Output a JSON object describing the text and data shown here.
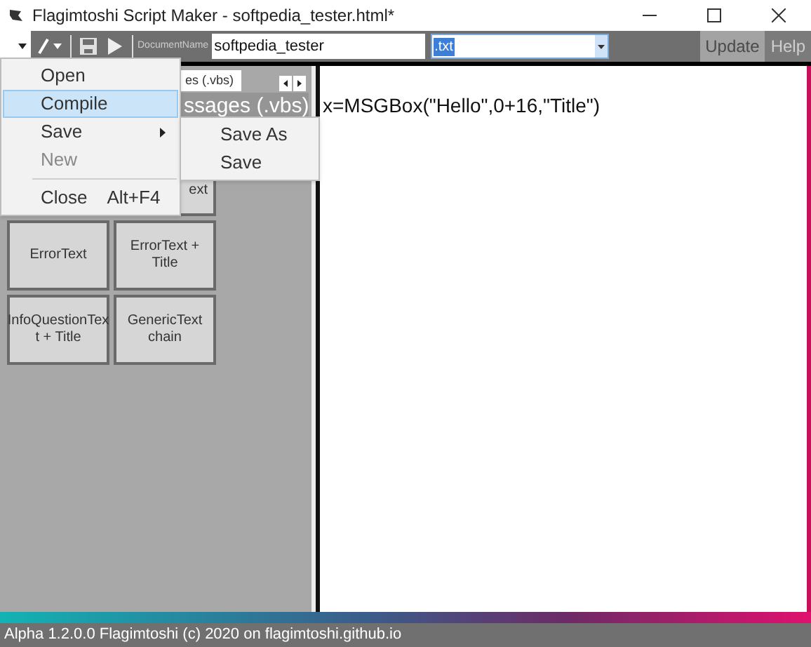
{
  "window": {
    "title": "Flagimtoshi Script Maker - softpedia_tester.html*"
  },
  "toolbar": {
    "document_name_label": "DocumentName",
    "document_name": "softpedia_tester",
    "extension": ".txt",
    "buttons": [
      {
        "label": "Update",
        "kind": "update"
      },
      {
        "label": "Help",
        "kind": "help"
      }
    ]
  },
  "left_panel": {
    "tab": "es (.vbs)",
    "header": "ssages (.vbs)",
    "templates": [
      {
        "label": "ext"
      },
      {
        "label": "ErrorText"
      },
      {
        "label": "ErrorText + Title"
      },
      {
        "label": "InfoQuestionTex t + Title"
      },
      {
        "label": "GenericText chain"
      }
    ]
  },
  "editor": {
    "text": "x=MSGBox(\"Hello\",0+16,\"Title\")"
  },
  "menu": {
    "items": [
      {
        "kind": "item",
        "label": "Open",
        "selected": false,
        "disabled": false
      },
      {
        "kind": "item",
        "label": "Compile",
        "selected": true,
        "disabled": false
      },
      {
        "kind": "submenu",
        "label": "Save",
        "selected": false,
        "disabled": false
      },
      {
        "kind": "item",
        "label": "New",
        "selected": false,
        "disabled": true
      },
      {
        "kind": "separator"
      },
      {
        "kind": "item",
        "label": "Close",
        "shortcut": "Alt+F4",
        "selected": false,
        "disabled": false
      }
    ],
    "submenu": [
      "Save As",
      "Save"
    ]
  },
  "status_bar": {
    "text": "Alpha 1.2.0.0 Flagimtoshi (c) 2020 on flagimtoshi.github.io"
  }
}
